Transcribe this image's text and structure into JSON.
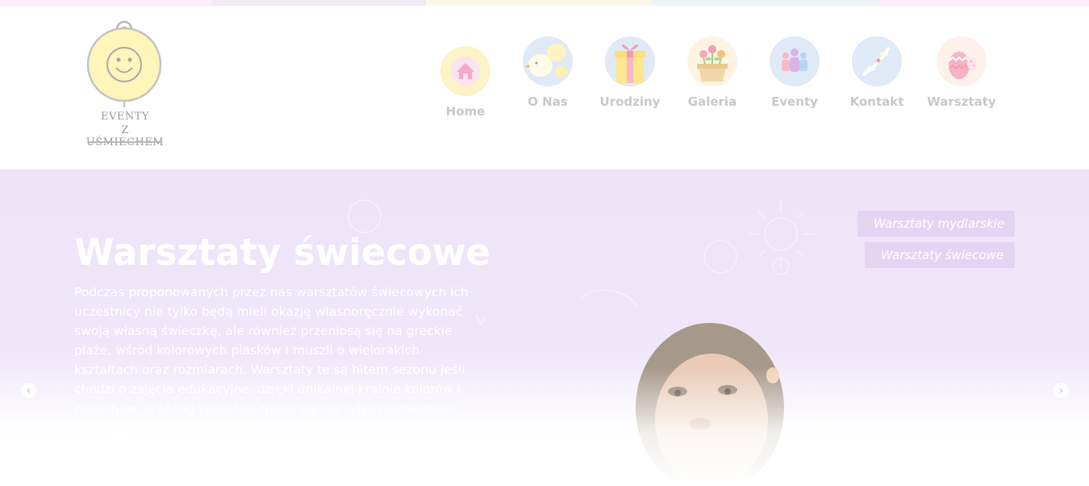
{
  "topstrip": {
    "colors": [
      "#fbeefa",
      "#f3e9f6",
      "#fdf6e6",
      "#eef3fa",
      "#fbeef6"
    ]
  },
  "logo": {
    "line1": "EVENTY",
    "line2": "Z UŚMIECHEM"
  },
  "nav": {
    "items": [
      {
        "label": "Home",
        "icon": "home-icon",
        "bg": "#fcf3c6"
      },
      {
        "label": "O Nas",
        "icon": "chicks-icon",
        "bg": "#dfeaf6"
      },
      {
        "label": "Urodziny",
        "icon": "gift-icon",
        "bg": "#dfeaf6"
      },
      {
        "label": "Galeria",
        "icon": "flowerpot-icon",
        "bg": "#fdf3e0"
      },
      {
        "label": "Eventy",
        "icon": "people-icon",
        "bg": "#dfeaf6"
      },
      {
        "label": "Kontakt",
        "icon": "birds-icon",
        "bg": "#dfeaf6"
      },
      {
        "label": "Warsztaty",
        "icon": "easter-egg-icon",
        "bg": "#fdf1ea"
      }
    ]
  },
  "hero": {
    "title": "Warsztaty świecowe",
    "text": "Podczas proponowanych przez nas warsztatów świecowych ich uczestnicy nie tylko będą mieli okazję własnoręcznie wykonać swoją własną świeczkę, ale również przeniosą się na greckie plaże, wśród kolorowych piasków i muszli o wielorakich kształtach oraz rozmiarach. Warsztaty te są hitem sezonu jeśli chodzi o zajęcia edukacyjne, dzięki unikalnej krainie kolorów i zapachów, w której zakochać mogą się nie tylko najmłodsze szkraby, ale również dorośli!",
    "tags": [
      "Warsztaty mydlarskie",
      "Warsztaty świecowe"
    ],
    "prev_arrow": "‹",
    "next_arrow": "›"
  }
}
